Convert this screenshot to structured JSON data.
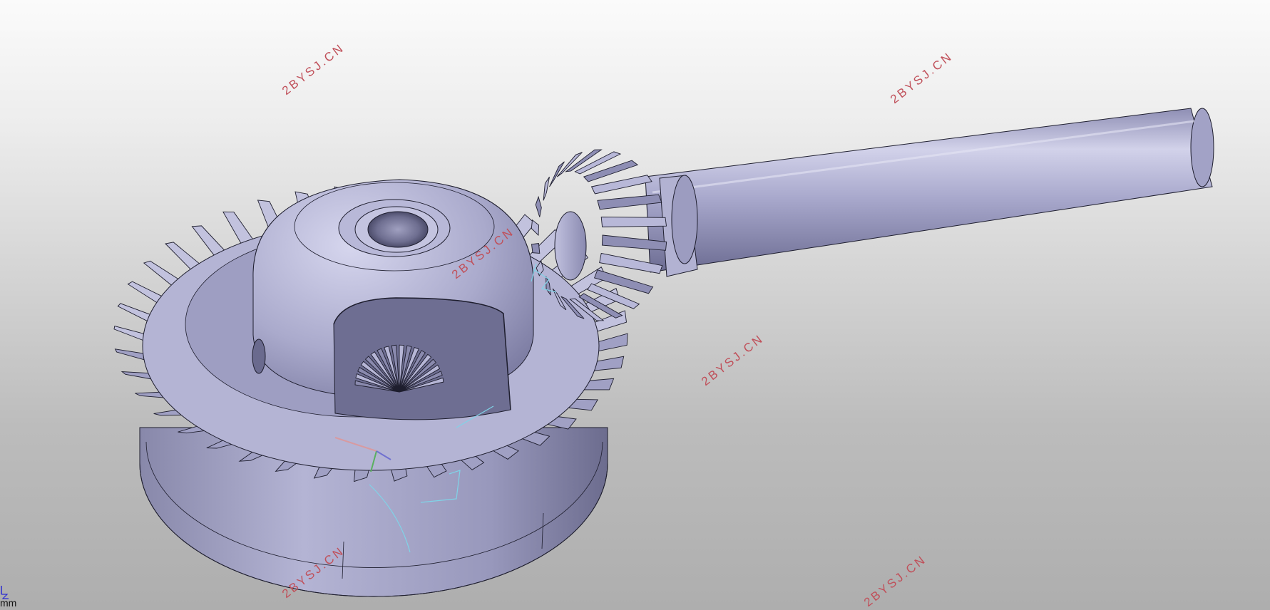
{
  "viewer": {
    "unit_label": "mm",
    "background_top": "#fbfbfb",
    "background_bottom": "#aeaeae",
    "part_color": "#a9a9cc",
    "edge_color": "#1e1e2e",
    "sketch_color": "#7fd4e8"
  },
  "model": {
    "name": "bevel-gear-differential-assembly",
    "components": [
      "ring-gear",
      "differential-case",
      "pinion-gear",
      "pinion-shaft",
      "side-gear"
    ]
  },
  "watermarks": {
    "text": "2BYSJ.CN",
    "color": "#c0505a",
    "items": [
      {
        "text": "2BYSJ.CN"
      },
      {
        "text": "2BYSJ.CN"
      },
      {
        "text": "2BYSJ.CN"
      },
      {
        "text": "2BYSJ.CN"
      },
      {
        "text": "2BYSJ.CN"
      },
      {
        "text": "2BYSJ.CN"
      }
    ]
  }
}
